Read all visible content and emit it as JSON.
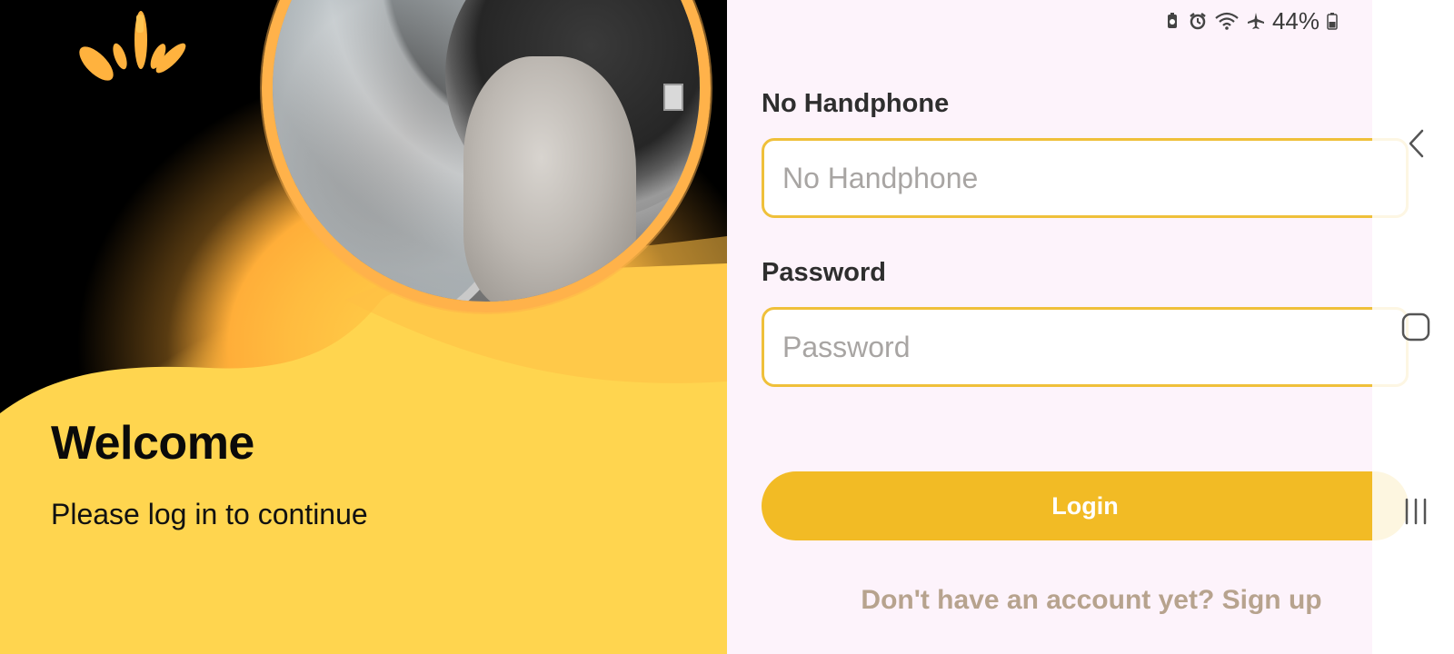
{
  "hero": {
    "title": "Welcome",
    "subtitle": "Please log in to continue",
    "icon": "sun-rays-logo-icon",
    "image": "washing-machine-towel-photo"
  },
  "status_bar": {
    "battery_percent": "44%",
    "icons": [
      "battery-saver-icon",
      "alarm-icon",
      "wifi-icon",
      "airplane-mode-icon",
      "battery-icon"
    ]
  },
  "form": {
    "phone_label": "No Handphone",
    "phone_placeholder": "No Handphone",
    "phone_value": "",
    "password_label": "Password",
    "password_placeholder": "Password",
    "password_value": "",
    "login_label": "Login",
    "signup_text": "Don't have an account yet? Sign up"
  },
  "navigation": {
    "back": "back-icon",
    "home": "home-icon",
    "recents": "recents-icon"
  },
  "colors": {
    "accent": "#f2bb25",
    "input_border": "#efc03a",
    "panel_bg": "#fdf3fb",
    "signup_text": "#b7a38e",
    "hero_yellow": "#ffd54f",
    "hero_orange": "#ffb24a"
  }
}
